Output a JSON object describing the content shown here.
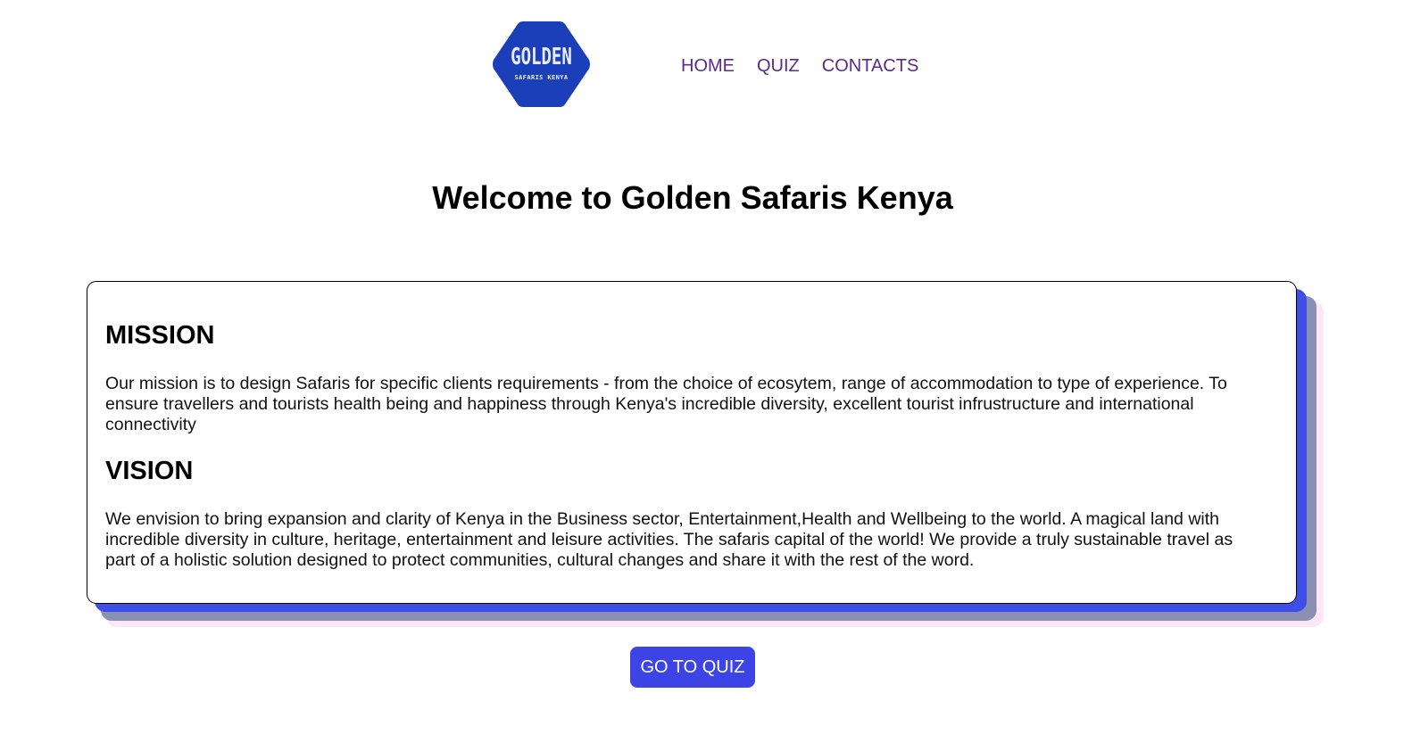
{
  "header": {
    "logo": {
      "line1": "GOLDEN",
      "line2": "SAFARIS KENYA"
    },
    "nav": [
      "HOME",
      "QUIZ",
      "CONTACTS"
    ]
  },
  "main": {
    "title": "Welcome to Golden Safaris Kenya",
    "mission": {
      "heading": "MISSION",
      "text": "Our mission is to design Safaris for specific clients requirements - from the choice of ecosytem, range of accommodation to type of experience. To ensure travellers and tourists health being and happiness through Kenya's incredible diversity, excellent tourist infrustructure and international connectivity"
    },
    "vision": {
      "heading": "VISION",
      "text": "We envision to bring expansion and clarity of Kenya in the Business sector, Entertainment,Health and Wellbeing to the world. A magical land with incredible diversity in culture, heritage, entertainment and leisure activities. The safaris capital of the world! We provide a truly sustainable travel as part of a holistic solution designed to protect communities, cultural changes and share it with the rest of the word."
    },
    "cta_label": "GO TO QUIZ"
  },
  "colors": {
    "logo_bg": "#1a3fb8",
    "nav_link": "#5b2a86",
    "button_bg": "#3d44e6",
    "shadow_blue": "#3d4fe6",
    "shadow_gray": "#8a8fb4",
    "shadow_pink": "#fde6f5"
  }
}
